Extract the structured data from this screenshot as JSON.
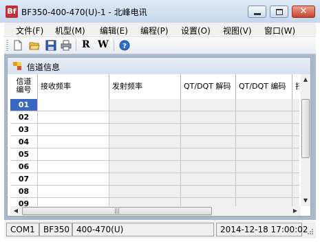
{
  "window": {
    "logo_text": "Bf",
    "title": "BF350-400-470(U)-1 - 北峰电讯",
    "minimize_label": "",
    "maximize_label": "",
    "close_label": "✕"
  },
  "menu": [
    "文件(F)",
    "机型(M)",
    "编辑(E)",
    "编程(P)",
    "设置(O)",
    "视图(V)",
    "窗口(W)"
  ],
  "toolbar": {
    "icons": [
      "new-file-icon",
      "open-folder-icon",
      "save-icon",
      "print-icon",
      "read-icon",
      "write-icon",
      "help-icon"
    ],
    "read_label": "R",
    "write_label": "W",
    "help_label": "?"
  },
  "child_window": {
    "title": "信道信息",
    "columns": [
      "信道\n编号",
      "接收频率",
      "发射频率",
      "QT/DQT 解码",
      "QT/DQT 编码",
      "扫"
    ],
    "rows": [
      {
        "num": "01",
        "rx": "",
        "tx": "",
        "qt_dec": "",
        "qt_enc": "",
        "selected": true
      },
      {
        "num": "02",
        "rx": "",
        "tx": "",
        "qt_dec": "",
        "qt_enc": ""
      },
      {
        "num": "03",
        "rx": "",
        "tx": "",
        "qt_dec": "",
        "qt_enc": ""
      },
      {
        "num": "04",
        "rx": "",
        "tx": "",
        "qt_dec": "",
        "qt_enc": ""
      },
      {
        "num": "05",
        "rx": "",
        "tx": "",
        "qt_dec": "",
        "qt_enc": ""
      },
      {
        "num": "06",
        "rx": "",
        "tx": "",
        "qt_dec": "",
        "qt_enc": ""
      },
      {
        "num": "07",
        "rx": "",
        "tx": "",
        "qt_dec": "",
        "qt_enc": ""
      },
      {
        "num": "08",
        "rx": "",
        "tx": "",
        "qt_dec": "",
        "qt_enc": ""
      },
      {
        "num": "09",
        "rx": "",
        "tx": "",
        "qt_dec": "",
        "qt_enc": ""
      }
    ]
  },
  "statusbar": {
    "port": "COM1",
    "model": "BF350",
    "band": "400-470(U)",
    "datetime": "2014-12-18 17:00:02"
  },
  "colors": {
    "selected_row": "#3a66c4",
    "titlebar": "#d3e1f1",
    "close_button": "#c7432b"
  }
}
